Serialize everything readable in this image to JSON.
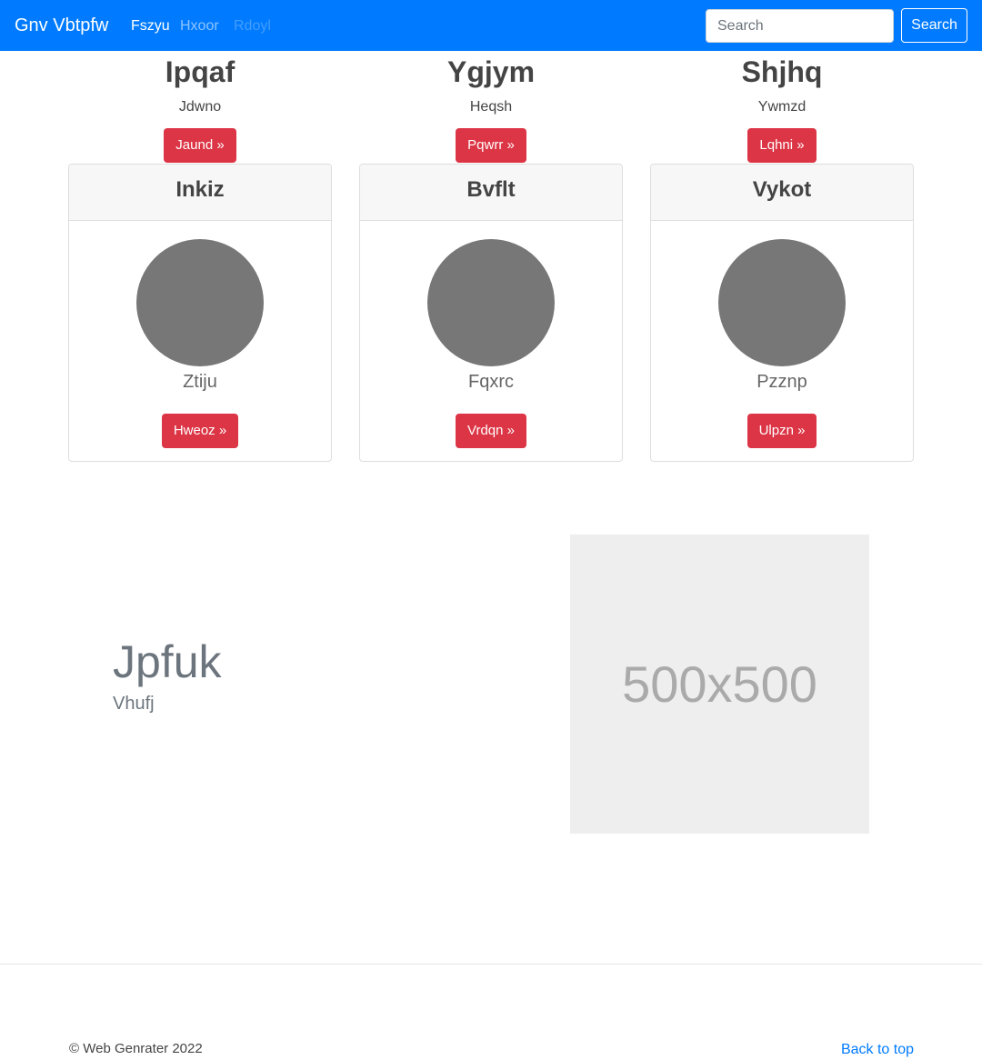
{
  "navbar": {
    "brand": "Gnv Vbtpfw",
    "links": [
      "Fszyu",
      "Hxoor",
      "Rdoyl"
    ],
    "search_placeholder": "Search",
    "search_button": "Search"
  },
  "features": [
    {
      "title": "Ipqaf",
      "text": "Jdwno",
      "button": "Jaund »"
    },
    {
      "title": "Ygjym",
      "text": "Heqsh",
      "button": "Pqwrr »"
    },
    {
      "title": "Shjhq",
      "text": "Ywmzd",
      "button": "Lqhni »"
    }
  ],
  "cards": [
    {
      "header": "Inkiz",
      "name": "Ztiju",
      "button": "Hweoz »"
    },
    {
      "header": "Bvflt",
      "name": "Fqxrc",
      "button": "Vrdqn »"
    },
    {
      "header": "Vykot",
      "name": "Pzznp",
      "button": "Ulpzn »"
    }
  ],
  "featurette": {
    "heading": "Jpfuk",
    "subheading": "Vhufj",
    "image_label": "500x500"
  },
  "footer": {
    "copyright": "© Web Genrater 2022",
    "back_to_top": "Back to top"
  },
  "colors": {
    "primary": "#007bff",
    "danger": "#dc3545",
    "avatar": "#777777",
    "placeholder_bg": "#eeeeee"
  }
}
